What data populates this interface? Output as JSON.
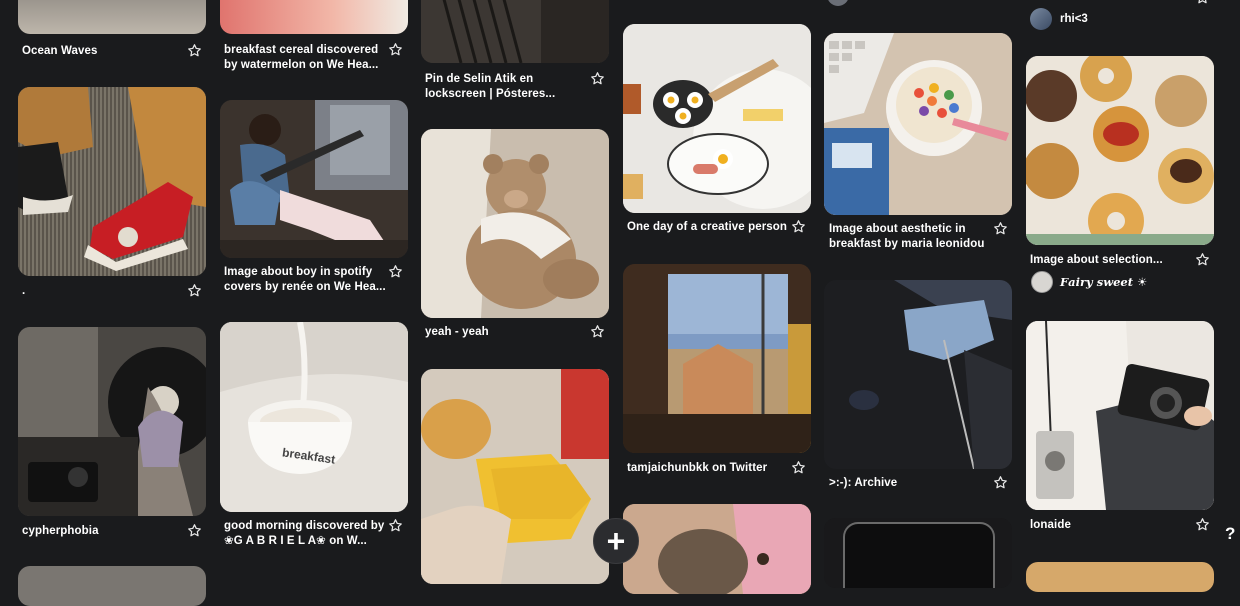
{
  "pins": [
    {
      "caption": "Ocean Waves"
    },
    {
      "caption": "."
    },
    {
      "caption": "cypherphobia"
    },
    {
      "caption": "breakfast cereal discovered\nby watermelon on We Hea..."
    },
    {
      "caption": "Image about boy in spotify\ncovers by renée on We Hea..."
    },
    {
      "caption": "good morning discovered by\n❀G A B R I E L A❀ on W..."
    },
    {
      "caption": "Pin de Selin Atik en\nlockscreen | Pósteres..."
    },
    {
      "caption": "yeah - yeah"
    },
    {
      "caption": "One day of a creative person"
    },
    {
      "caption": "tamjaichunbkk on Twitter"
    },
    {
      "caption": "Image about aesthetic in\nbreakfast by maria leonidou"
    },
    {
      "caption": ">:-): Archive"
    },
    {
      "caption": "Image about selection..."
    },
    {
      "caption": "lonaide"
    }
  ],
  "users": [
    {
      "name": "rhi<3"
    },
    {
      "name": "𝑭𝒂𝒊𝒓𝒚 𝒔𝒘𝒆𝒆𝒕 ☀"
    }
  ],
  "image_texts": {
    "breakfast_bowl": "breakfast"
  },
  "fab_symbol": "+",
  "help_symbol": "?",
  "icons": {
    "save": "star-outline-icon",
    "create": "plus-icon",
    "help": "question-mark-icon"
  },
  "colors": {
    "background": "#1a1b1d",
    "text": "#ffffff",
    "fab_background": "#2b2c2f"
  }
}
